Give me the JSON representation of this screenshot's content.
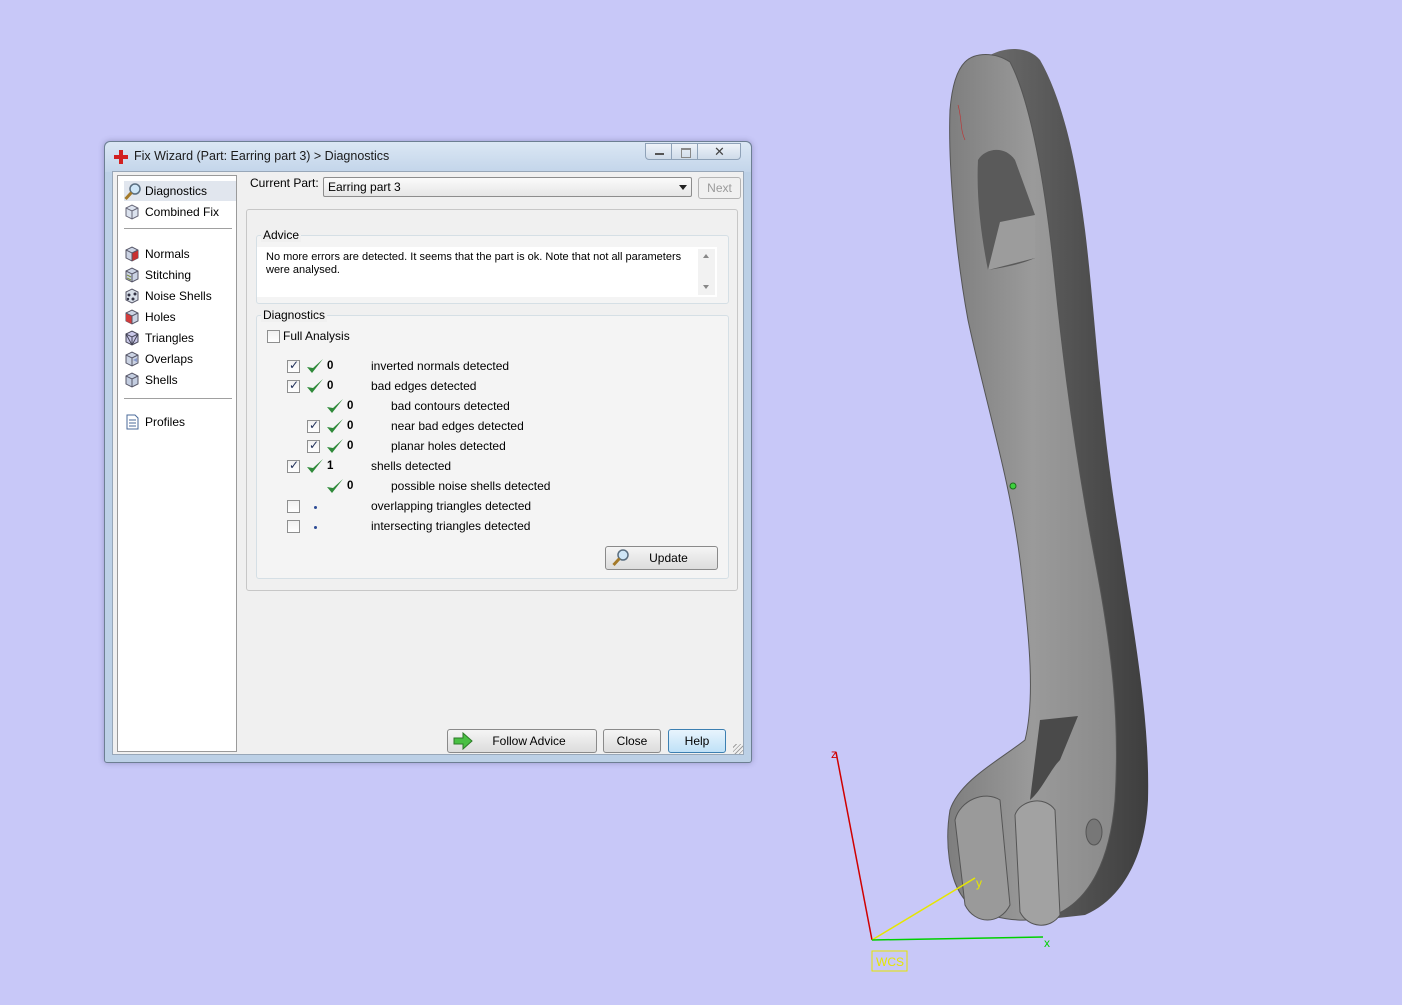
{
  "window": {
    "title": "Fix Wizard (Part: Earring part 3) > Diagnostics"
  },
  "nav": {
    "items": [
      {
        "label": "Diagnostics",
        "icon": "magnifier-icon",
        "selected": true
      },
      {
        "label": "Combined Fix",
        "icon": "cube-icon"
      },
      {
        "label": "Normals",
        "icon": "cube-red-face-icon"
      },
      {
        "label": "Stitching",
        "icon": "cube-stitch-icon"
      },
      {
        "label": "Noise Shells",
        "icon": "noise-cube-icon"
      },
      {
        "label": "Holes",
        "icon": "cube-red-icon"
      },
      {
        "label": "Triangles",
        "icon": "cube-triangles-icon"
      },
      {
        "label": "Overlaps",
        "icon": "cube-overlap-icon"
      },
      {
        "label": "Shells",
        "icon": "cube-icon"
      },
      {
        "label": "Profiles",
        "icon": "document-icon"
      }
    ]
  },
  "current_part": {
    "label": "Current Part:",
    "value": "Earring part 3",
    "next_label": "Next"
  },
  "advice": {
    "title": "Advice",
    "text": "No more errors are detected. It seems that the part is ok. Note that not all parameters were analysed."
  },
  "diagnostics": {
    "title": "Diagnostics",
    "full_analysis_label": "Full Analysis",
    "full_analysis_checked": false,
    "rows": [
      {
        "checked": true,
        "status": "ok",
        "count": "0",
        "label": "inverted normals detected",
        "indent": 0,
        "has_checkbox": true
      },
      {
        "checked": true,
        "status": "ok",
        "count": "0",
        "label": "bad edges detected",
        "indent": 0,
        "has_checkbox": true
      },
      {
        "checked": false,
        "status": "ok",
        "count": "0",
        "label": "bad contours detected",
        "indent": 1,
        "has_checkbox": false
      },
      {
        "checked": true,
        "status": "ok",
        "count": "0",
        "label": "near bad edges detected",
        "indent": 1,
        "has_checkbox": true
      },
      {
        "checked": true,
        "status": "ok",
        "count": "0",
        "label": "planar holes detected",
        "indent": 1,
        "has_checkbox": true
      },
      {
        "checked": true,
        "status": "ok",
        "count": "1",
        "label": "shells detected",
        "indent": 0,
        "has_checkbox": true
      },
      {
        "checked": false,
        "status": "ok",
        "count": "0",
        "label": "possible noise shells detected",
        "indent": 1,
        "has_checkbox": false
      },
      {
        "checked": false,
        "status": "pending",
        "count": "",
        "label": "overlapping triangles detected",
        "indent": 0,
        "has_checkbox": true
      },
      {
        "checked": false,
        "status": "pending",
        "count": "",
        "label": "intersecting triangles detected",
        "indent": 0,
        "has_checkbox": true
      }
    ],
    "update_label": "Update"
  },
  "footer": {
    "follow_advice_label": "Follow Advice",
    "close_label": "Close",
    "help_label": "Help"
  },
  "viewport": {
    "axis_z": "z",
    "axis_y": "y",
    "axis_x": "x",
    "wcs_label": "WCS",
    "background_color": "#c8c8f8",
    "model_color": "#8a8a8a"
  }
}
